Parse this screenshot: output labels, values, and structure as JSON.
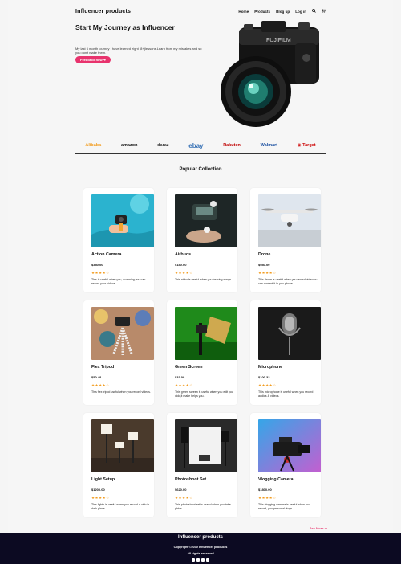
{
  "nav": {
    "brand": "Influencer products",
    "links": [
      "Home",
      "Products",
      "Blog up",
      "Log in"
    ],
    "search_icon": "search-icon",
    "cart_icon": "cart-icon"
  },
  "hero": {
    "title": "Start My Journey as Influencer",
    "text": "My last 6 month journey I have learned eight (8+)lessons.Learn from my mistakes and so you don't make them.",
    "button": "Feedback now"
  },
  "brands": [
    "Alibaba",
    "amazon",
    "daraz",
    "ebay",
    "Rakuten",
    "Walmart",
    "Target"
  ],
  "section_title": "Popular Collection",
  "products": [
    {
      "name": "Action Camera",
      "price": "$380.00",
      "stars": "★★★★☆",
      "desc": "This is useful when you, scanning you can record your videos."
    },
    {
      "name": "Airbuds",
      "price": "$180.00",
      "stars": "★★★★☆",
      "desc": "This airbuds useful when you hearing songs"
    },
    {
      "name": "Drone",
      "price": "$980.00",
      "stars": "★★★★☆",
      "desc": "This drone is useful when you record video/ou can contact it in you phone."
    },
    {
      "name": "Flex Tripod",
      "price": "$50.48",
      "stars": "★★★★☆",
      "desc": "This flex tripod useful when you record videos."
    },
    {
      "name": "Green Screen",
      "price": "$33.00",
      "stars": "★★★★☆",
      "desc": "This green screen is useful when you edit you vido,it make helps you."
    },
    {
      "name": "Microphone",
      "price": "$100.33",
      "stars": "★★★★☆",
      "desc": "This microphone is useful when you record audios & videos."
    },
    {
      "name": "Light Setup",
      "price": "$1200.00",
      "stars": "★★★★☆",
      "desc": "This lights is useful when you record a vido in dark place."
    },
    {
      "name": "Photoshoot Set",
      "price": "$620.00",
      "stars": "★★★★☆",
      "desc": "This photoshoot set is useful when you take phtos."
    },
    {
      "name": "Vlogging Camera",
      "price": "$1800.00",
      "stars": "★★★★☆",
      "desc": "This vlogging camera is useful when you record, you personal vlogs."
    }
  ],
  "see_more": "See More",
  "footer": {
    "title": "Influencer products",
    "copy": "Copyright ©2030 Influencer products",
    "rights": "All rights reserved"
  },
  "colors": {
    "accent": "#e8336d",
    "footer_bg": "#0c0a22",
    "star": "#f29c1f"
  }
}
